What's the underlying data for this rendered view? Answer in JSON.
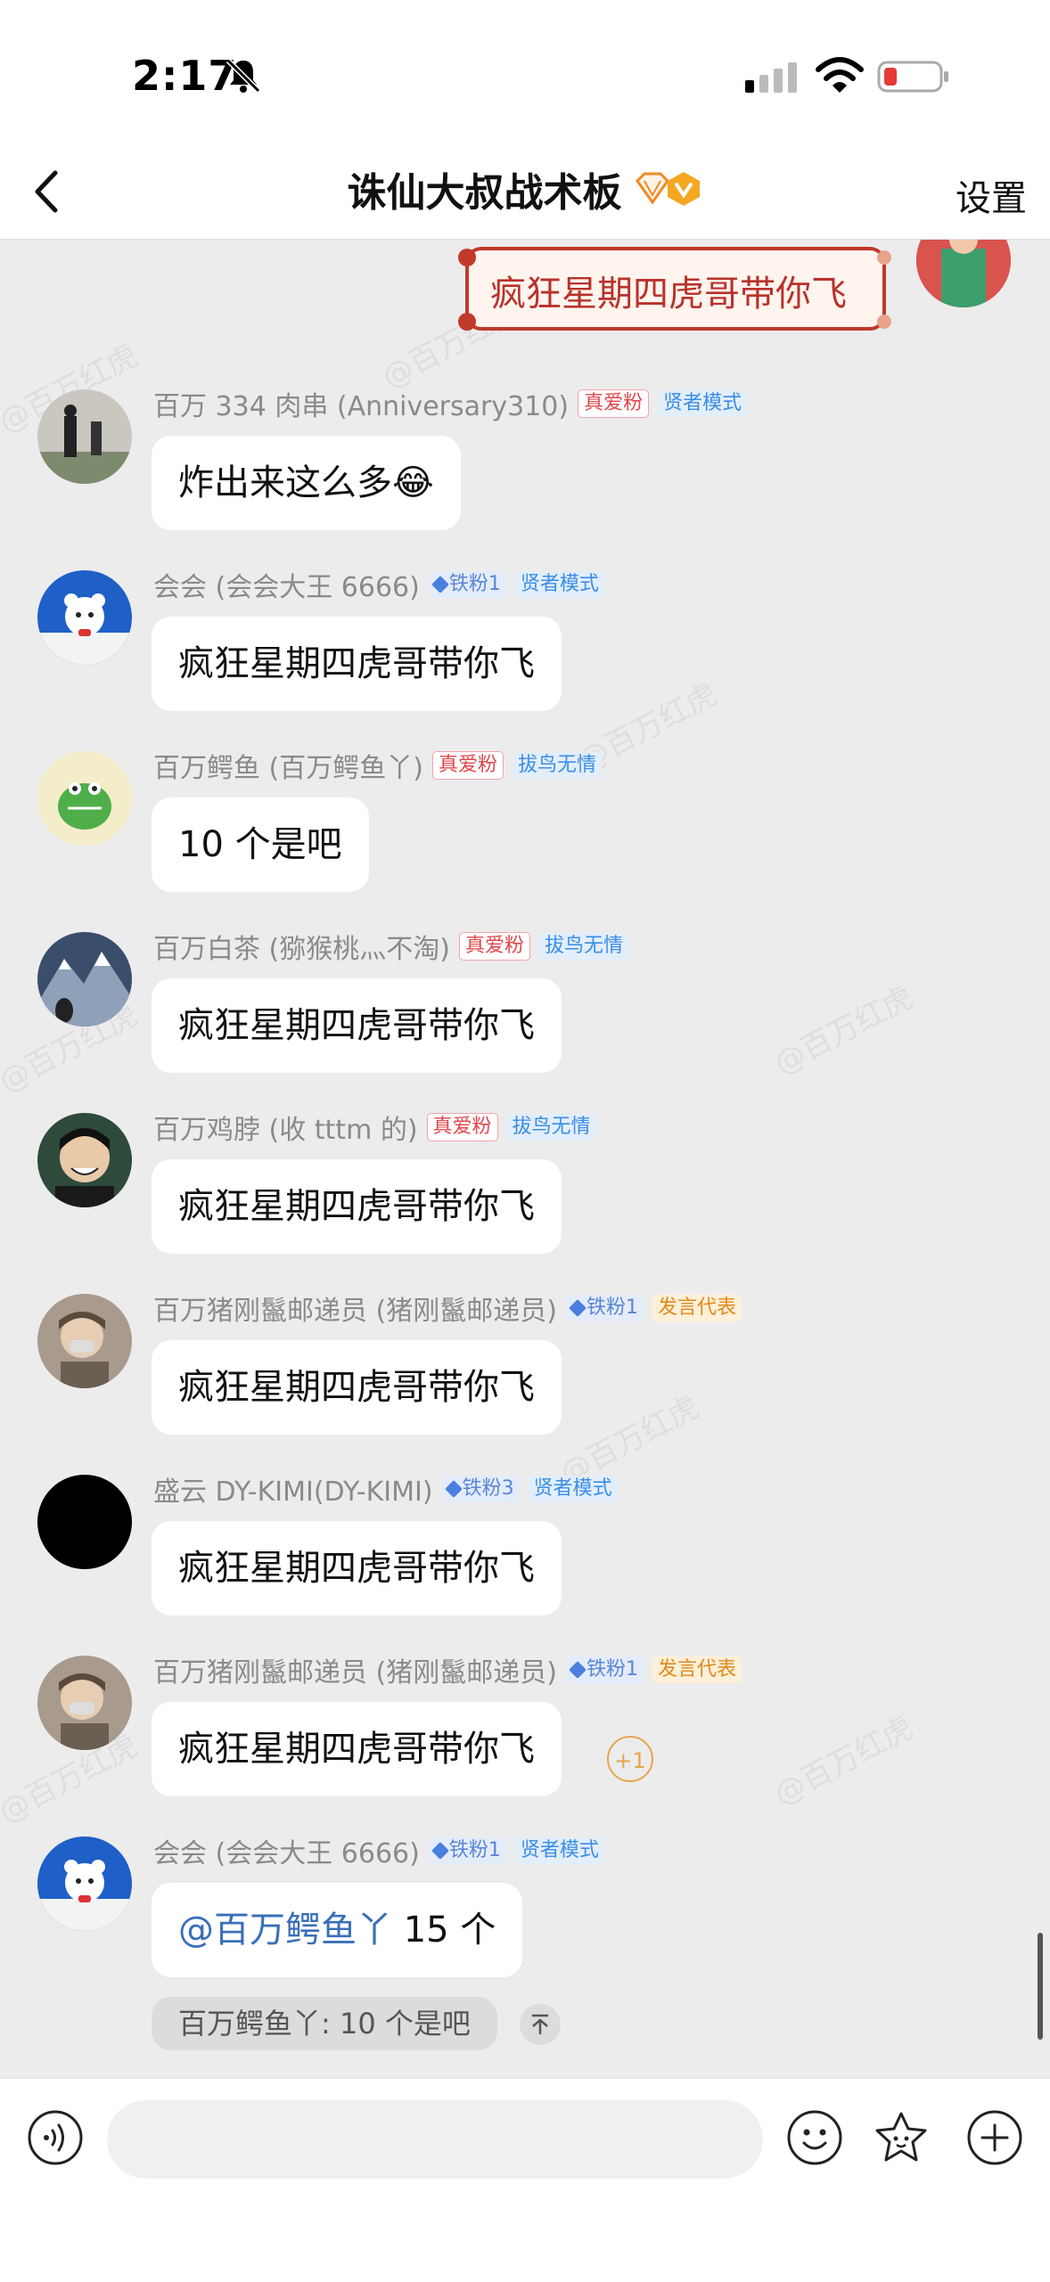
{
  "status_bar": {
    "time": "2:17"
  },
  "header": {
    "title": "诛仙大叔战术板",
    "settings_label": "设置"
  },
  "watermark": "@百万红虎",
  "self_message": {
    "text": "疯狂星期四虎哥带你飞"
  },
  "messages": [
    {
      "name": "百万 334 肉串 (Anniversary310)",
      "tags": [
        "真爱粉",
        "贤者模式"
      ],
      "text": "炸出来这么多",
      "emoji": "😂"
    },
    {
      "name": "会会 (会会大王 6666)",
      "tags": [
        "铁粉1",
        "贤者模式"
      ],
      "text": "疯狂星期四虎哥带你飞"
    },
    {
      "name": "百万鳄鱼 (百万鳄鱼丫)",
      "tags": [
        "真爱粉",
        "拔鸟无情"
      ],
      "text": "10 个是吧"
    },
    {
      "name": "百万白茶 (猕猴桃灬不淘)",
      "tags": [
        "真爱粉",
        "拔鸟无情"
      ],
      "text": "疯狂星期四虎哥带你飞"
    },
    {
      "name": "百万鸡脖 (收 tttm 的)",
      "tags": [
        "真爱粉",
        "拔鸟无情"
      ],
      "text": "疯狂星期四虎哥带你飞"
    },
    {
      "name": "百万猪刚鬣邮递员 (猪刚鬣邮递员)",
      "tags": [
        "铁粉1",
        "发言代表"
      ],
      "text": "疯狂星期四虎哥带你飞"
    },
    {
      "name": "盛云 DY-KIMI(DY-KIMI)",
      "tags": [
        "铁粉3",
        "贤者模式"
      ],
      "text": "疯狂星期四虎哥带你飞"
    },
    {
      "name": "百万猪刚鬣邮递员 (猪刚鬣邮递员)",
      "tags": [
        "铁粉1",
        "发言代表"
      ],
      "text": "疯狂星期四虎哥带你飞",
      "plus_one": "+1"
    },
    {
      "name": "会会 (会会大王 6666)",
      "tags": [
        "铁粉1",
        "贤者模式"
      ],
      "mention": "@百万鳄鱼丫",
      "text": "15 个"
    }
  ],
  "quote": {
    "text": "百万鳄鱼丫: 10 个是吧"
  }
}
